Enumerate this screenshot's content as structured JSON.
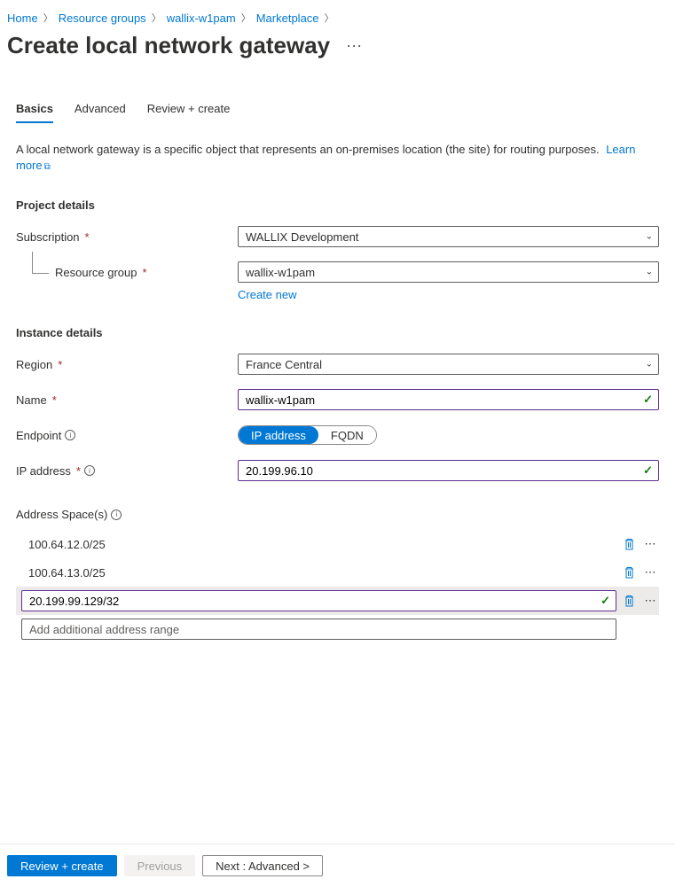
{
  "breadcrumb": [
    {
      "label": "Home"
    },
    {
      "label": "Resource groups"
    },
    {
      "label": "wallix-w1pam"
    },
    {
      "label": "Marketplace"
    }
  ],
  "title": "Create local network gateway",
  "tabs": {
    "basics": "Basics",
    "advanced": "Advanced",
    "review": "Review + create"
  },
  "intro": {
    "text": "A local network gateway is a specific object that represents an on-premises location (the site) for routing purposes.",
    "learn_more": "Learn more"
  },
  "sections": {
    "project_details": "Project details",
    "instance_details": "Instance details"
  },
  "fields": {
    "subscription": {
      "label": "Subscription",
      "value": "WALLIX Development"
    },
    "resource_group": {
      "label": "Resource group",
      "value": "wallix-w1pam",
      "create_new": "Create new"
    },
    "region": {
      "label": "Region",
      "value": "France Central"
    },
    "name": {
      "label": "Name",
      "value": "wallix-w1pam"
    },
    "endpoint": {
      "label": "Endpoint",
      "options": {
        "ip": "IP address",
        "fqdn": "FQDN"
      }
    },
    "ip_address": {
      "label": "IP address",
      "value": "20.199.96.10"
    },
    "address_spaces": {
      "label": "Address Space(s)",
      "rows": [
        "100.64.12.0/25",
        "100.64.13.0/25"
      ],
      "editing": "20.199.99.129/32",
      "placeholder": "Add additional address range"
    }
  },
  "footer": {
    "review": "Review + create",
    "previous": "Previous",
    "next": "Next : Advanced >"
  }
}
